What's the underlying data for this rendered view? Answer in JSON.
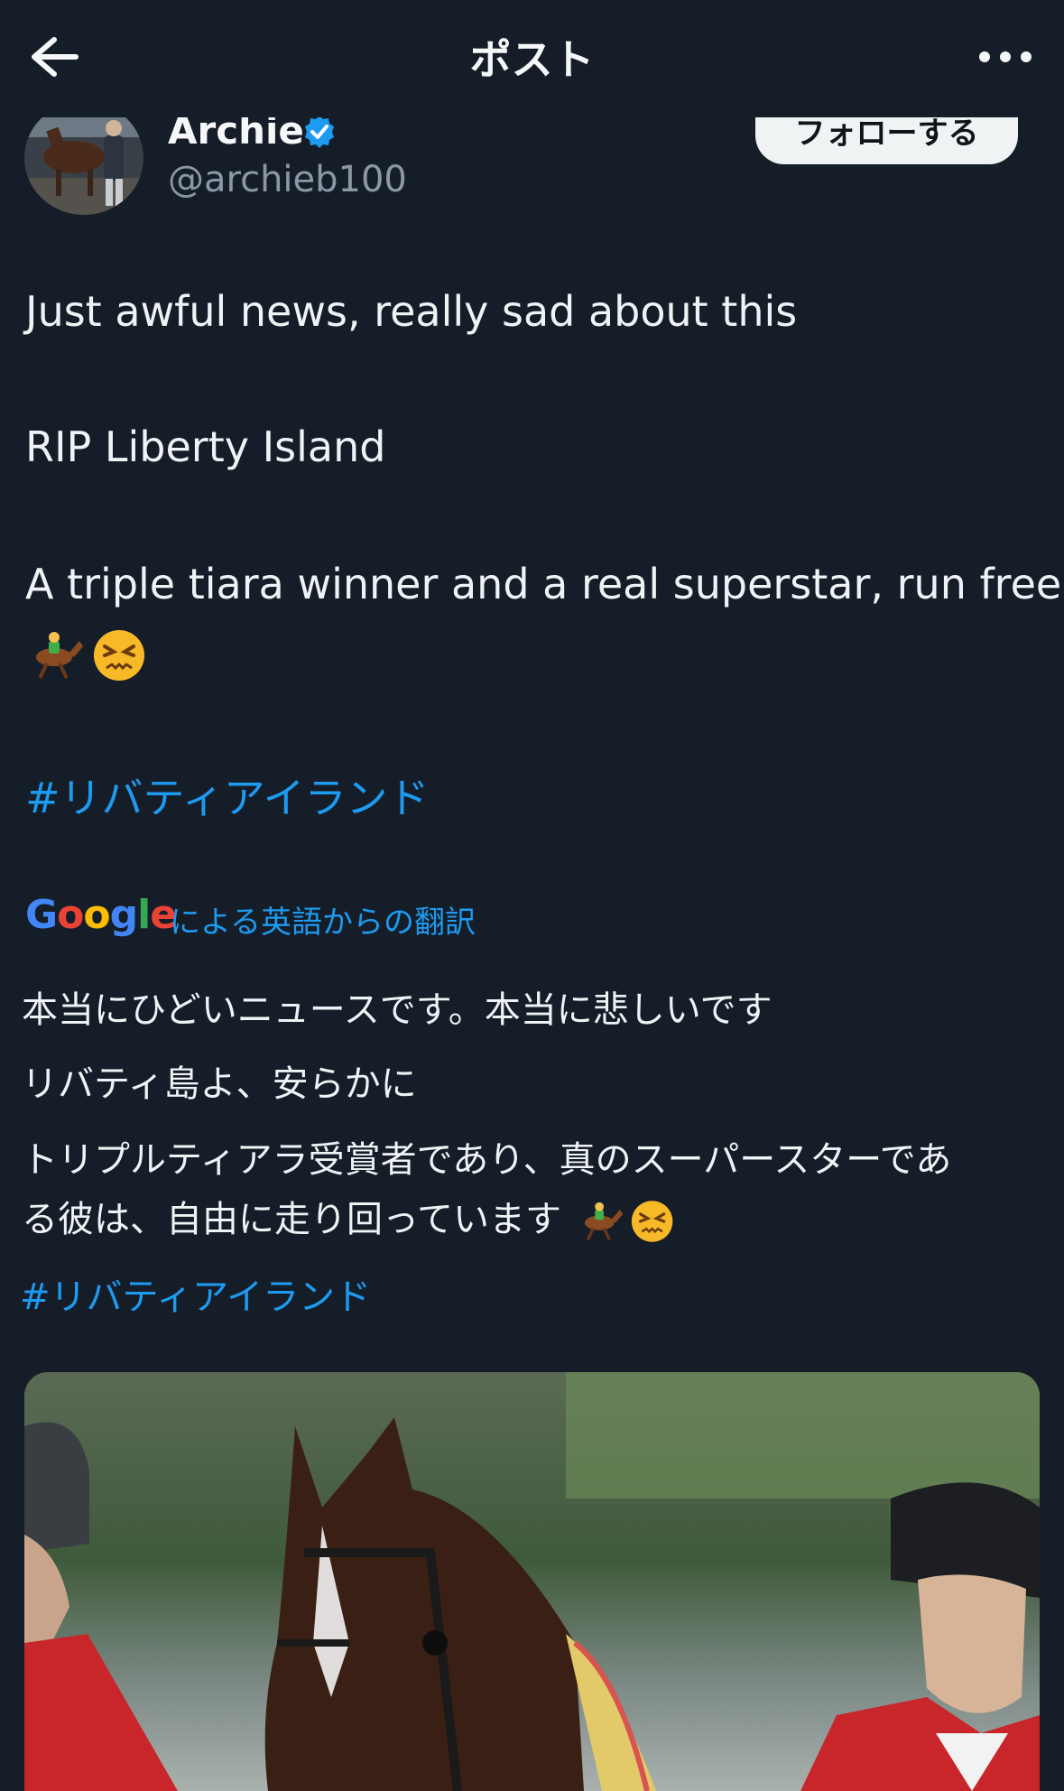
{
  "header": {
    "title": "ポスト"
  },
  "author": {
    "name": "Archie",
    "handle": "@archieb100",
    "follow_label": "フォローする"
  },
  "post": {
    "lines": [
      "Just awful news, really sad about this",
      "RIP Liberty Island",
      "A triple tiara winner and a real superstar, run free"
    ],
    "emojis": [
      "🏇",
      "😖"
    ],
    "hashtag": "#リバティアイランド"
  },
  "translation": {
    "provider_logo": [
      "G",
      "o",
      "o",
      "g",
      "l",
      "e"
    ],
    "label": "による英語からの翻訳",
    "lines": [
      "本当にひどいニュースです。本当に悲しいです",
      "リバティ島よ、安らかに",
      "トリプルティアラ受賞者であり、真のスーパースターであ",
      "る彼は、自由に走り回っています"
    ],
    "hashtag": "#リバティアイランド"
  },
  "colors": {
    "background": "#151d28",
    "link": "#1d9bf0",
    "verified": "#1d9bf0",
    "secondary_text": "#8b98a5"
  }
}
